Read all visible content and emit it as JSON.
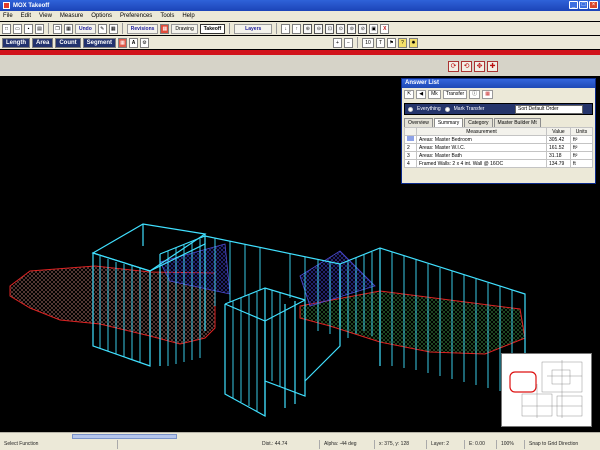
{
  "app": {
    "title": "MOX Takeoff"
  },
  "window_buttons": [
    "_",
    "□",
    "×"
  ],
  "menu": [
    "File",
    "Edit",
    "View",
    "Measure",
    "Options",
    "Preferences",
    "Tools",
    "Help"
  ],
  "toolbar1": {
    "buttons": [
      "Undo",
      "Revisions",
      "Drawing",
      "Takeoff",
      "Layers"
    ]
  },
  "toolbar2": {
    "buttons": [
      "Length",
      "Area",
      "Count",
      "Segment"
    ],
    "zoom_value": "10"
  },
  "nav_buttons": [
    "⟳",
    "⟲",
    "✥",
    "✚"
  ],
  "panel": {
    "title": "Answer List",
    "tools": [
      "Mk",
      "Transfer"
    ],
    "modes": [
      "Everything",
      "Mark Transfer"
    ],
    "dropdown": "Sort Default Order",
    "tabs": [
      "Overview",
      "Summary",
      "Category",
      "Master Builder Mt"
    ],
    "columns": [
      "",
      "Measurement",
      "Value",
      "Units"
    ],
    "rows": [
      {
        "id": "",
        "name": "Areas: Master Bedroom",
        "value": "305.42",
        "unit": "ft²"
      },
      {
        "id": "2",
        "name": "Areas: Master W.I.C.",
        "value": "161.52",
        "unit": "ft²"
      },
      {
        "id": "3",
        "name": "Areas: Master Bath",
        "value": "31.18",
        "unit": "ft²"
      },
      {
        "id": "4",
        "name": "Framed Walls: 2 x 4 int. Wall @ 16OC",
        "value": "134.79",
        "unit": "ft"
      }
    ]
  },
  "status": [
    "Select Function",
    "Dist.: 44.74",
    "Alpha: -44 deg",
    "x: 375, y: 128",
    "Layer: 2",
    "E: 0.00",
    "100%",
    "Snap to Grid Direction"
  ],
  "colors": {
    "wall": "#40e0ff",
    "floor_blue": "#1a1a8c",
    "floor_green": "#2e7a36",
    "floor_salmon": "#7a3f3a",
    "titlebar": "#1c44b8",
    "red_bar": "#d1121b"
  }
}
